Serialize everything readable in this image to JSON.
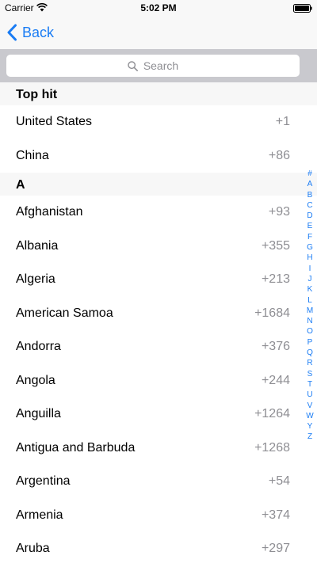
{
  "status_bar": {
    "carrier": "Carrier",
    "time": "5:02 PM"
  },
  "nav": {
    "back_label": "Back",
    "accent_color": "#1a7cf4"
  },
  "search": {
    "placeholder": "Search"
  },
  "sections": [
    {
      "title": "Top hit",
      "rows": [
        {
          "name": "United States",
          "code": "+1"
        },
        {
          "name": "China",
          "code": "+86"
        }
      ]
    },
    {
      "title": "A",
      "rows": [
        {
          "name": "Afghanistan",
          "code": "+93"
        },
        {
          "name": "Albania",
          "code": "+355"
        },
        {
          "name": "Algeria",
          "code": "+213"
        },
        {
          "name": "American Samoa",
          "code": "+1684"
        },
        {
          "name": "Andorra",
          "code": "+376"
        },
        {
          "name": "Angola",
          "code": "+244"
        },
        {
          "name": "Anguilla",
          "code": "+1264"
        },
        {
          "name": "Antigua and Barbuda",
          "code": "+1268"
        },
        {
          "name": "Argentina",
          "code": "+54"
        },
        {
          "name": "Armenia",
          "code": "+374"
        },
        {
          "name": "Aruba",
          "code": "+297"
        }
      ]
    }
  ],
  "section_index": [
    "#",
    "A",
    "B",
    "C",
    "D",
    "E",
    "F",
    "G",
    "H",
    "I",
    "J",
    "K",
    "L",
    "M",
    "N",
    "O",
    "P",
    "Q",
    "R",
    "S",
    "T",
    "U",
    "V",
    "W",
    "Y",
    "Z"
  ]
}
